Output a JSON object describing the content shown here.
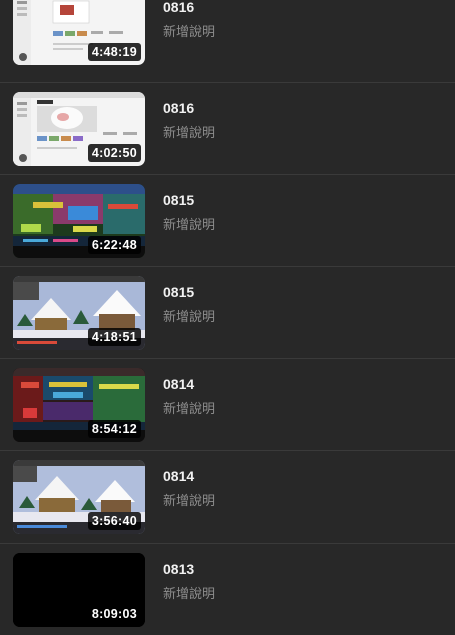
{
  "videos": [
    {
      "title": "0816",
      "description": "新增說明",
      "duration": "4:48:19",
      "thumbnail": "thumbnail-stream-screen"
    },
    {
      "title": "0816",
      "description": "新增說明",
      "duration": "4:02:50",
      "thumbnail": "thumbnail-stream-screen"
    },
    {
      "title": "0815",
      "description": "新增說明",
      "duration": "6:22:48",
      "thumbnail": "thumbnail-game-colorful"
    },
    {
      "title": "0815",
      "description": "新增說明",
      "duration": "4:18:51",
      "thumbnail": "thumbnail-game-snow"
    },
    {
      "title": "0814",
      "description": "新增說明",
      "duration": "8:54:12",
      "thumbnail": "thumbnail-game-colorful"
    },
    {
      "title": "0814",
      "description": "新增說明",
      "duration": "3:56:40",
      "thumbnail": "thumbnail-game-snow"
    },
    {
      "title": "0813",
      "description": "新增說明",
      "duration": "8:09:03",
      "thumbnail": "thumbnail-black"
    }
  ]
}
